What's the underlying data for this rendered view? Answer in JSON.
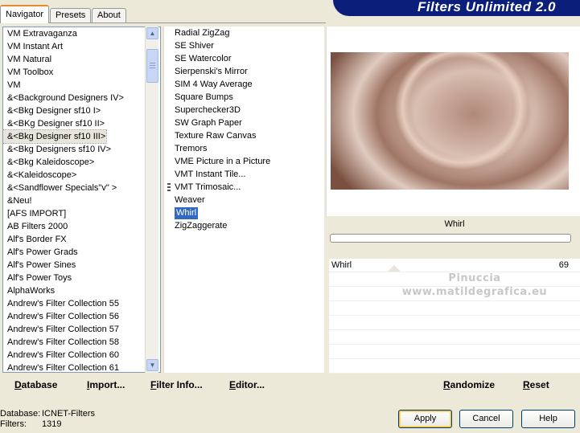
{
  "tabs": [
    "Navigator",
    "Presets",
    "About"
  ],
  "app_title": "Filters Unlimited 2.0",
  "categories": [
    "VM Extravaganza",
    "VM Instant Art",
    "VM Natural",
    "VM Toolbox",
    "VM",
    "&<Background Designers IV>",
    "&<Bkg Designer sf10 I>",
    "&<BKg Designer sf10 II>",
    "&<Bkg Designer sf10 III>",
    "&<Bkg Designers sf10 IV>",
    "&<Bkg Kaleidoscope>",
    "&<Kaleidoscope>",
    "&<Sandflower Specials\"v\" >",
    "&Neu!",
    "[AFS IMPORT]",
    "AB Filters 2000",
    "Alf's Border FX",
    "Alf's Power Grads",
    "Alf's Power Sines",
    "Alf's Power Toys",
    "AlphaWorks",
    "Andrew's Filter Collection 55",
    "Andrew's Filter Collection 56",
    "Andrew's Filter Collection 57",
    "Andrew's Filter Collection 58",
    "Andrew's Filter Collection 60",
    "Andrew's Filter Collection 61"
  ],
  "selected_category": "&<Bkg Designer sf10 III>",
  "filters": [
    "Radial ZigZag",
    "SE Shiver",
    "SE Watercolor",
    "Sierpenski's Mirror",
    "SIM 4 Way Average",
    "Square Bumps",
    "Superchecker3D",
    "SW Graph Paper",
    "Texture Raw Canvas",
    "Tremors",
    "VME Picture in a Picture",
    "VMT Instant Tile...",
    "VMT Trimosaic...",
    "Weaver",
    "Whirl",
    "ZigZaggerate"
  ],
  "selected_filter": "Whirl",
  "preview_filter_name": "Whirl",
  "params": [
    {
      "label": "Whirl",
      "value": "69"
    }
  ],
  "watermark": [
    "Pinuccia",
    "www.matildegrafica.eu"
  ],
  "links": {
    "database": "Database",
    "import": "Import...",
    "filter_info": "Filter Info...",
    "editor": "Editor...",
    "randomize": "Randomize",
    "reset": "Reset"
  },
  "status": {
    "database_label": "Database:",
    "database_value": "ICNET-Filters",
    "filters_label": "Filters:",
    "filters_value": "1319"
  },
  "buttons": {
    "apply": "Apply",
    "cancel": "Cancel",
    "help": "Help"
  },
  "colors": {
    "banner": "#0b1f7a",
    "selection": "#316ac5",
    "window": "#ece9d8"
  }
}
